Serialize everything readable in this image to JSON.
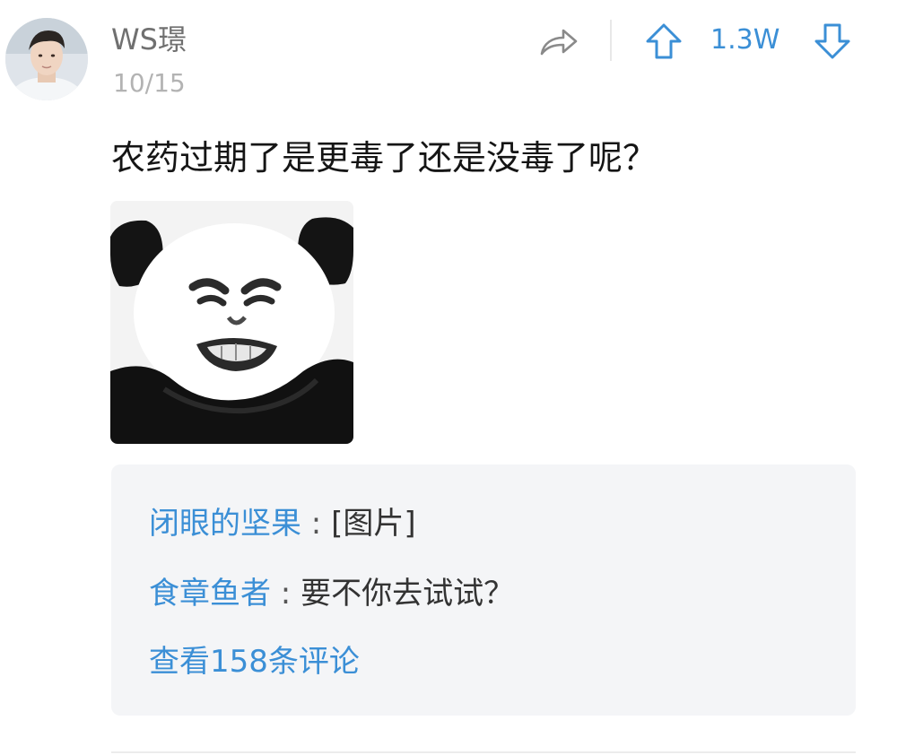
{
  "post": {
    "author": "WS璟",
    "date": "10/15",
    "text": "农药过期了是更毒了还是没毒了呢？",
    "vote_count": "1.3W",
    "image_alt": "panda meme face"
  },
  "icons": {
    "share": "share-arrow-icon",
    "upvote": "arrow-up-icon",
    "downvote": "arrow-down-icon"
  },
  "comments": [
    {
      "author": "闭眼的坚果",
      "separator": " : ",
      "text": "[图片]"
    },
    {
      "author": "食章鱼者",
      "separator": " : ",
      "text": "要不你去试试？"
    }
  ],
  "view_all_comments": "查看158条评论",
  "colors": {
    "accent": "#3b8fd6",
    "username": "#707070",
    "timestamp": "#b3b3b3",
    "comment_bg": "#f4f5f7"
  }
}
